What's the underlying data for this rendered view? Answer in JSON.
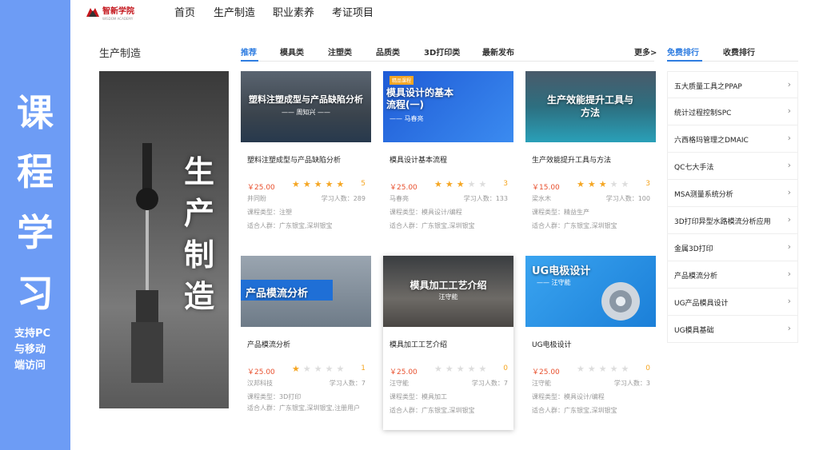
{
  "banner": {
    "chars": [
      "课",
      "程",
      "学",
      "习"
    ],
    "tagline": [
      "支持PC",
      "与移动",
      "端访问"
    ]
  },
  "header": {
    "logo_text": "智新学院",
    "logo_sub": "WISDOM ACADEMY",
    "nav": [
      "首页",
      "生产制造",
      "职业素养",
      "考证项目"
    ]
  },
  "section": {
    "title": "生产制造",
    "tabs": [
      "推荐",
      "模具类",
      "注塑类",
      "品质类",
      "3D打印类",
      "最新发布"
    ],
    "more": "更多>",
    "rank_tabs": [
      "免费排行",
      "收费排行"
    ]
  },
  "hero": {
    "text": [
      "生",
      "产",
      "制",
      "造"
    ]
  },
  "courses": [
    {
      "thumb_title": "塑料注塑成型与产品缺陷分析",
      "thumb_sub": "—— 周知兴 ——",
      "name": "塑料注塑成型与产品缺陷分析",
      "price": "￥25.00",
      "stars": 5,
      "rating": "5",
      "teacher": "井同盼",
      "learners": "学习人数：289",
      "type": "课程类型：注塑",
      "audience": "适合人群：广东银宝,深圳银宝"
    },
    {
      "thumb_badge": "精品课程",
      "thumb_title": "模具设计的基本流程(一)",
      "thumb_sub": "—— 马春亮",
      "name": "模具设计基本流程",
      "price": "￥25.00",
      "stars": 3,
      "rating": "3",
      "teacher": "马春亮",
      "learners": "学习人数：133",
      "type": "课程类型：模具设计/编程",
      "audience": "适合人群：广东银宝,深圳银宝"
    },
    {
      "thumb_title": "生产效能提升工具与方法",
      "thumb_sub": "",
      "name": "生产效能提升工具与方法",
      "price": "￥15.00",
      "stars": 3,
      "rating": "3",
      "teacher": "梁水木",
      "learners": "学习人数：100",
      "type": "课程类型：精益生产",
      "audience": "适合人群：广东银宝,深圳银宝"
    },
    {
      "thumb_title": "产品模流分析",
      "thumb_sub": "",
      "name": "产品模流分析",
      "price": "￥25.00",
      "stars": 1,
      "rating": "1",
      "teacher": "汉邦科技",
      "learners": "学习人数：7",
      "type": "课程类型：3D打印",
      "audience": "适合人群：广东银宝,深圳银宝,注册用户"
    },
    {
      "thumb_title": "模具加工工艺介绍",
      "thumb_sub": "汪守能",
      "name": "模具加工工艺介绍",
      "price": "￥25.00",
      "stars": 0,
      "rating": "0",
      "teacher": "汪守能",
      "learners": "学习人数：7",
      "type": "课程类型：模具加工",
      "audience": "适合人群：广东银宝,深圳银宝"
    },
    {
      "thumb_title": "UG电极设计",
      "thumb_sub": "—— 汪守能",
      "name": "UG电极设计",
      "price": "￥25.00",
      "stars": 0,
      "rating": "0",
      "teacher": "汪守能",
      "learners": "学习人数：3",
      "type": "课程类型：模具设计/编程",
      "audience": "适合人群：广东银宝,深圳银宝"
    }
  ],
  "ranking": [
    "五大质量工具之PPAP",
    "统计过程控制SPC",
    "六西格玛管理之DMAIC",
    "QC七大手法",
    "MSA测量系统分析",
    "3D打印异型水路模流分析应用",
    "金属3D打印",
    "产品模流分析",
    "UG产品模具设计",
    "UG模具基础"
  ],
  "colors": {
    "accent": "#2f7de1",
    "banner": "#6d9cf5",
    "price": "#e8512f",
    "star": "#f5a623"
  }
}
